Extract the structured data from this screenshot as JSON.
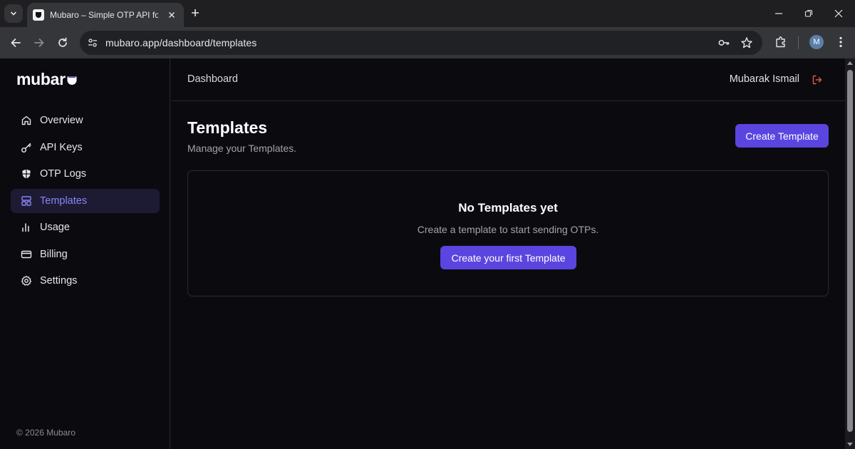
{
  "browser": {
    "tab_title": "Mubaro – Simple OTP API for Developers",
    "url": "mubaro.app/dashboard/templates",
    "profile_initial": "M",
    "icons": [
      "tab-search-icon",
      "close-icon",
      "plus-icon",
      "minimize-icon",
      "restore-icon",
      "back-icon",
      "forward-icon",
      "reload-icon",
      "site-settings-icon",
      "key-icon",
      "star-icon",
      "extensions-icon",
      "kebab-icon"
    ]
  },
  "brand": {
    "name": "mubar",
    "accent": "#5b45e0",
    "active_text": "#8b84f7"
  },
  "sidebar": {
    "items": [
      {
        "label": "Overview",
        "icon": "home-icon"
      },
      {
        "label": "API Keys",
        "icon": "key-icon"
      },
      {
        "label": "OTP Logs",
        "icon": "shield-icon"
      },
      {
        "label": "Templates",
        "icon": "layout-icon",
        "active": true
      },
      {
        "label": "Usage",
        "icon": "bar-chart-icon"
      },
      {
        "label": "Billing",
        "icon": "credit-card-icon"
      },
      {
        "label": "Settings",
        "icon": "gear-icon"
      }
    ],
    "footer": "© 2026 Mubaro"
  },
  "header": {
    "breadcrumb": "Dashboard",
    "user_name": "Mubarak Ismail",
    "logout_icon": "logout-icon",
    "logout_color": "#e05a4a"
  },
  "page": {
    "title": "Templates",
    "subtitle": "Manage your Templates.",
    "create_label": "Create Template"
  },
  "empty_state": {
    "title": "No Templates yet",
    "message": "Create a template to start sending OTPs.",
    "button_label": "Create your first Template"
  }
}
